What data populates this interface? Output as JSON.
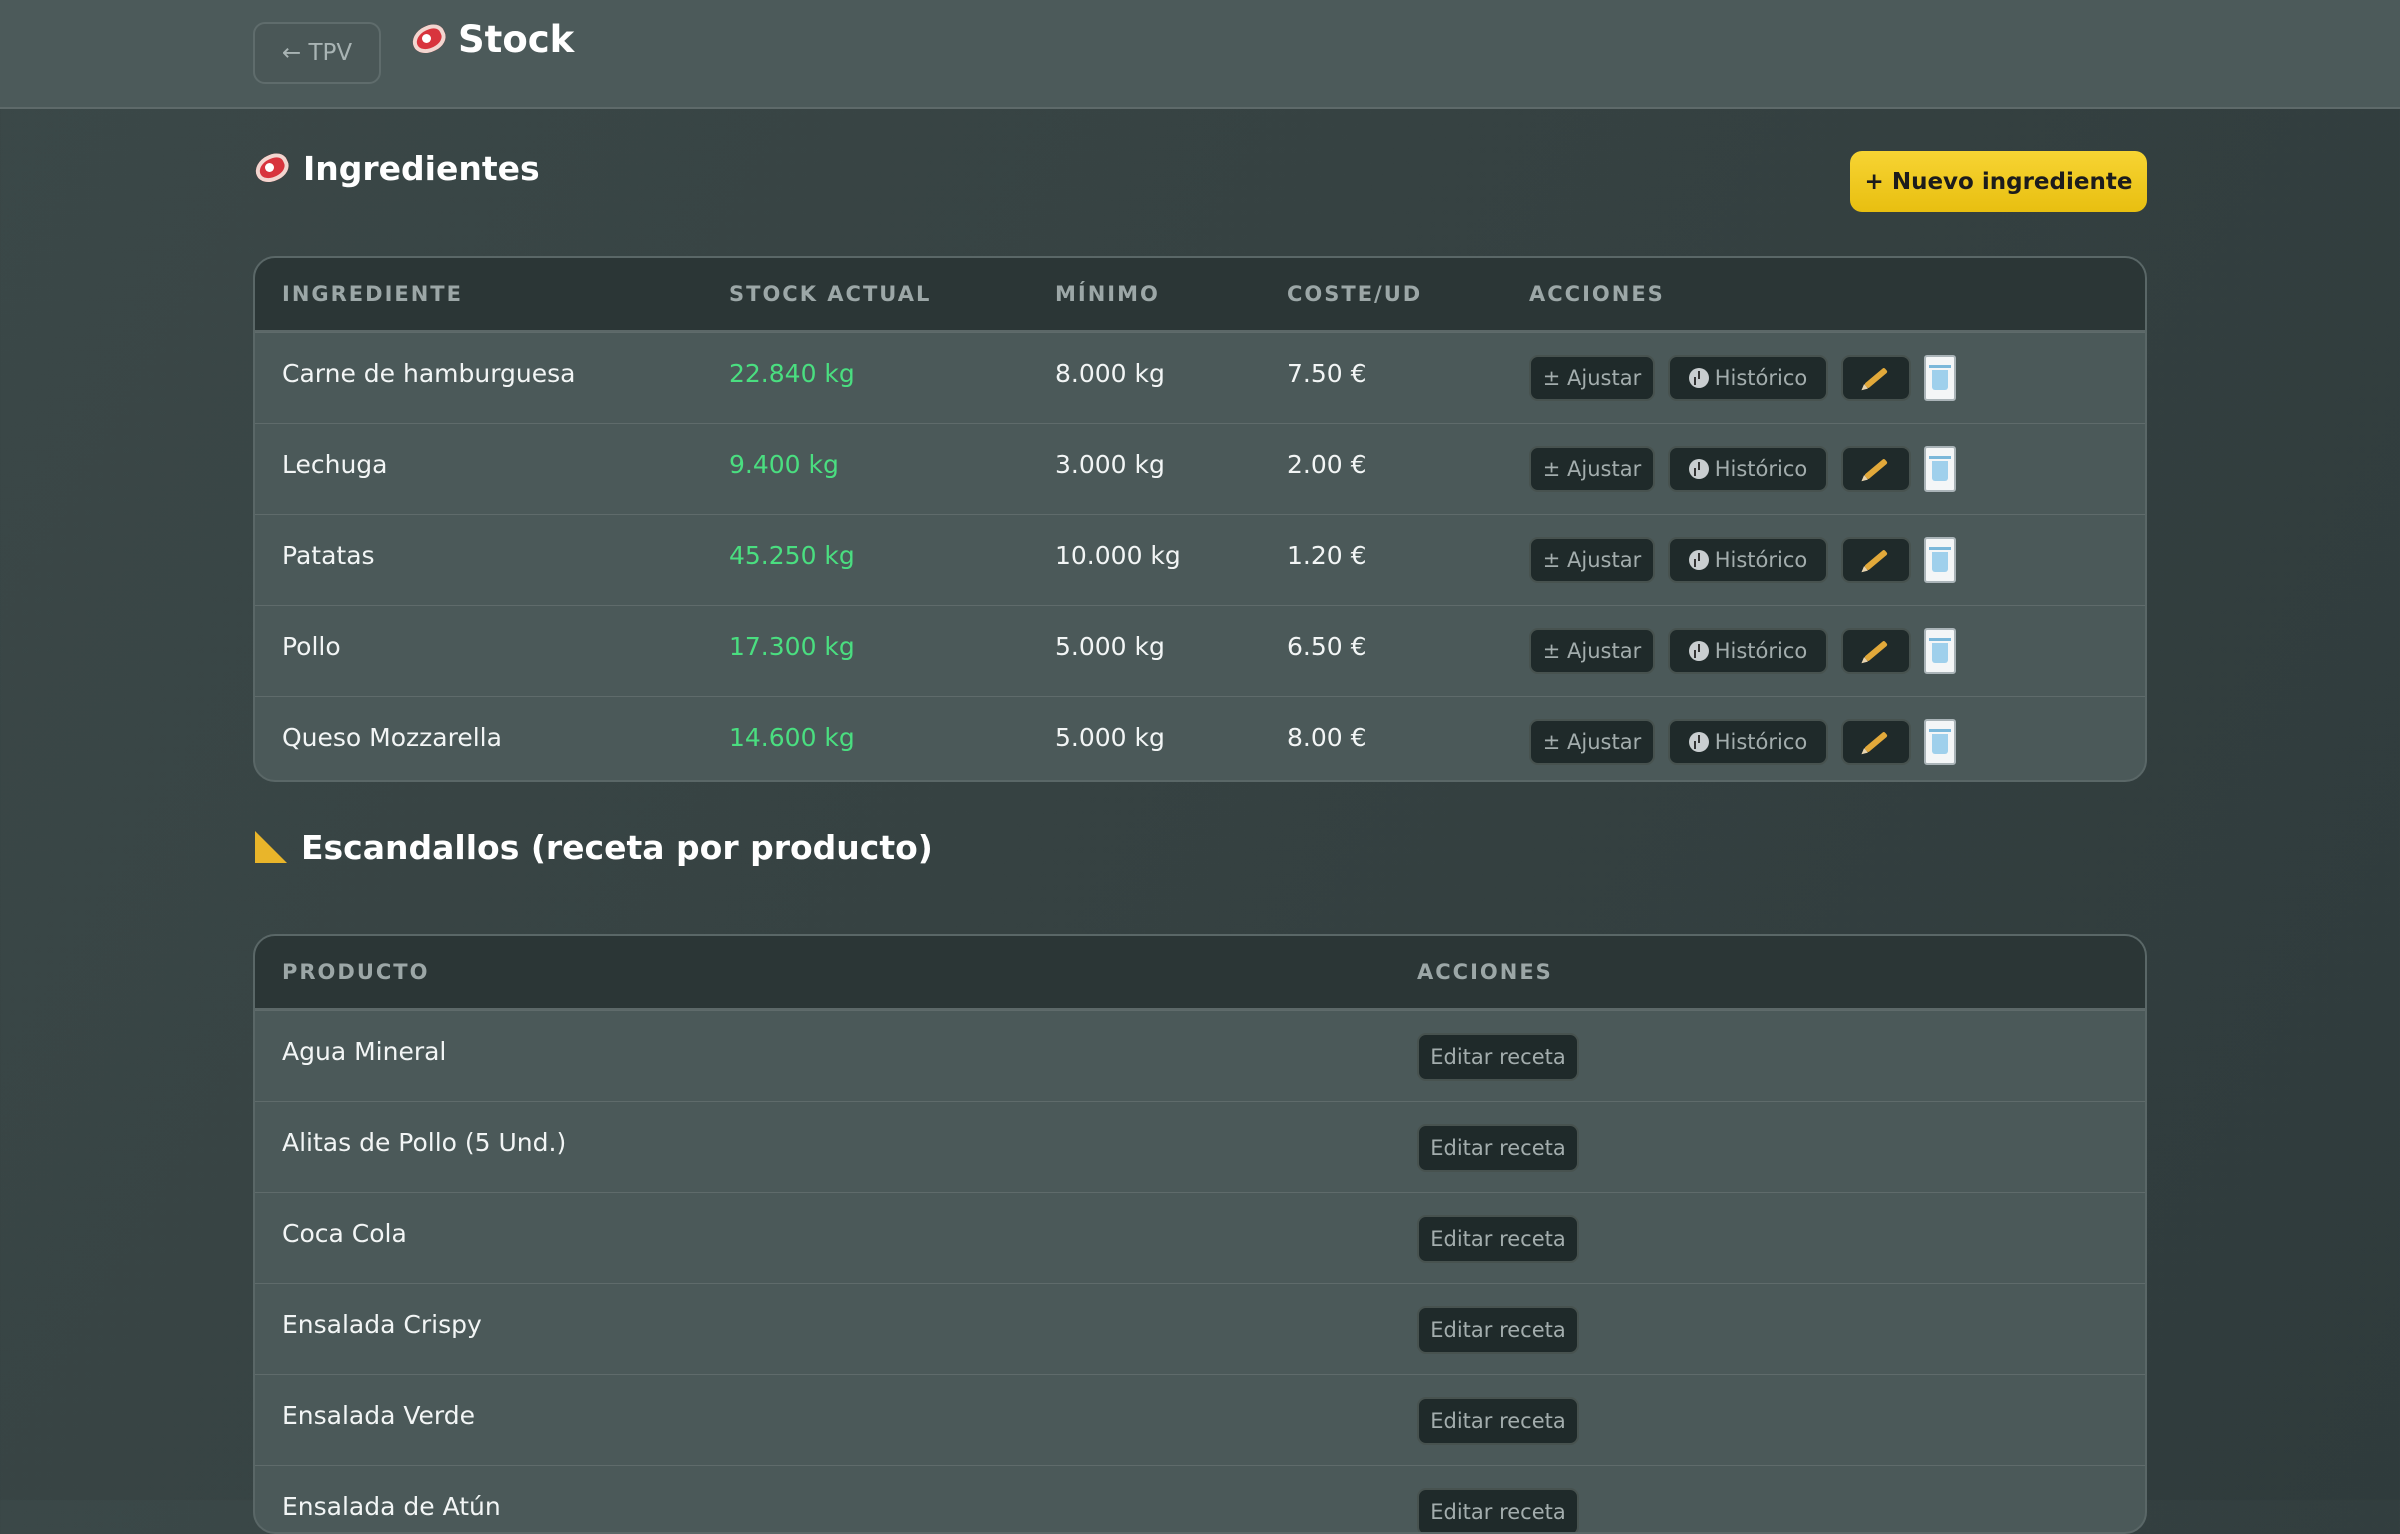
{
  "header": {
    "back_label": "← TPV",
    "title": "Stock"
  },
  "ingredients_section": {
    "title": "Ingredientes",
    "new_button": "+ Nuevo ingrediente",
    "columns": [
      "INGREDIENTE",
      "STOCK ACTUAL",
      "MÍNIMO",
      "COSTE/UD",
      "ACCIONES"
    ],
    "actions": {
      "adjust": "± Ajustar",
      "history": "Histórico"
    },
    "rows": [
      {
        "name": "Carne de hamburguesa",
        "stock": "22.840 kg",
        "min": "8.000 kg",
        "cost": "7.50 €"
      },
      {
        "name": "Lechuga",
        "stock": "9.400 kg",
        "min": "3.000 kg",
        "cost": "2.00 €"
      },
      {
        "name": "Patatas",
        "stock": "45.250 kg",
        "min": "10.000 kg",
        "cost": "1.20 €"
      },
      {
        "name": "Pollo",
        "stock": "17.300 kg",
        "min": "5.000 kg",
        "cost": "6.50 €"
      },
      {
        "name": "Queso Mozzarella",
        "stock": "14.600 kg",
        "min": "5.000 kg",
        "cost": "8.00 €"
      }
    ]
  },
  "recipes_section": {
    "title": "Escandallos (receta por producto)",
    "columns": [
      "PRODUCTO",
      "ACCIONES"
    ],
    "edit_label": "Editar receta",
    "rows": [
      {
        "name": "Agua Mineral"
      },
      {
        "name": "Alitas de Pollo (5 Und.)"
      },
      {
        "name": "Coca Cola"
      },
      {
        "name": "Ensalada Crispy"
      },
      {
        "name": "Ensalada Verde"
      },
      {
        "name": "Ensalada de Atún"
      }
    ]
  },
  "colors": {
    "accent": "#f2cd23",
    "stock_ok": "#4ade80",
    "table_header": "#2b3636",
    "row_bg": "#4b5959"
  }
}
